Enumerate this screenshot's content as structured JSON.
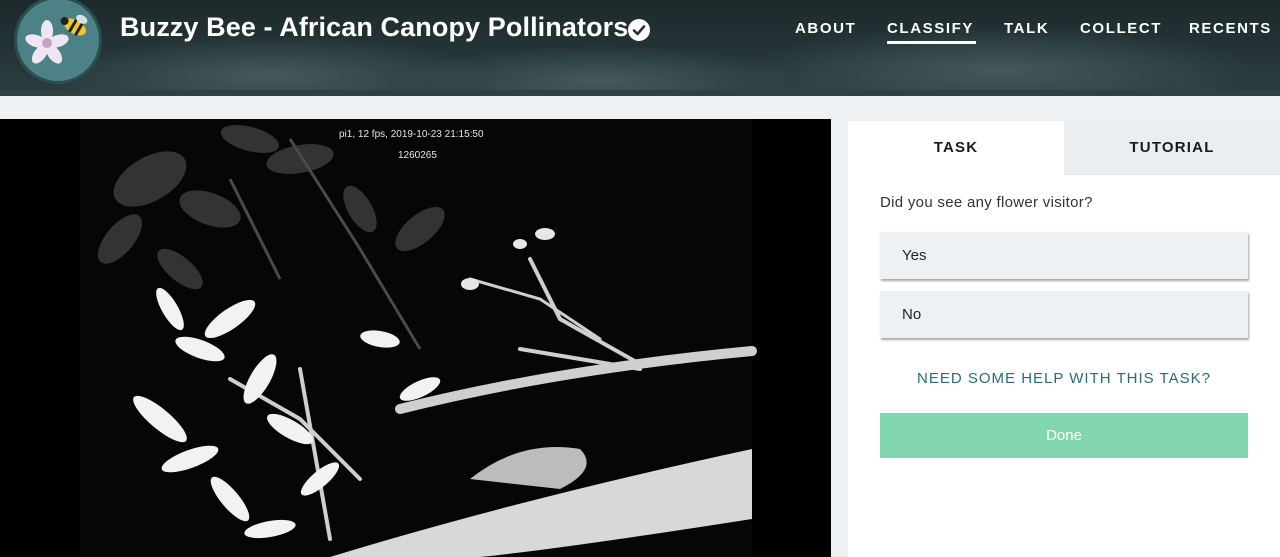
{
  "header": {
    "title": "Buzzy Bee - African Canopy Pollinators",
    "logo_icon": "bee-flower-logo-icon",
    "verified_icon": "verified-check-icon",
    "nav": [
      {
        "label": "ABOUT",
        "active": false
      },
      {
        "label": "CLASSIFY",
        "active": true
      },
      {
        "label": "TALK",
        "active": false
      },
      {
        "label": "COLLECT",
        "active": false
      },
      {
        "label": "RECENTS",
        "active": false
      }
    ]
  },
  "subject": {
    "overlay_line1": "pi1, 12 fps, 2019-10-23 21:15:50",
    "overlay_line2": "1260265"
  },
  "task_panel": {
    "tabs": [
      {
        "label": "TASK",
        "active": true
      },
      {
        "label": "TUTORIAL",
        "active": false
      }
    ],
    "question": "Did you see any flower visitor?",
    "answers": [
      "Yes",
      "No"
    ],
    "help_link": "NEED SOME HELP WITH THIS TASK?",
    "done_label": "Done"
  },
  "colors": {
    "done_button": "#82d6b0",
    "help_link": "#2a6b76",
    "answer_bg": "#eef1f4"
  }
}
